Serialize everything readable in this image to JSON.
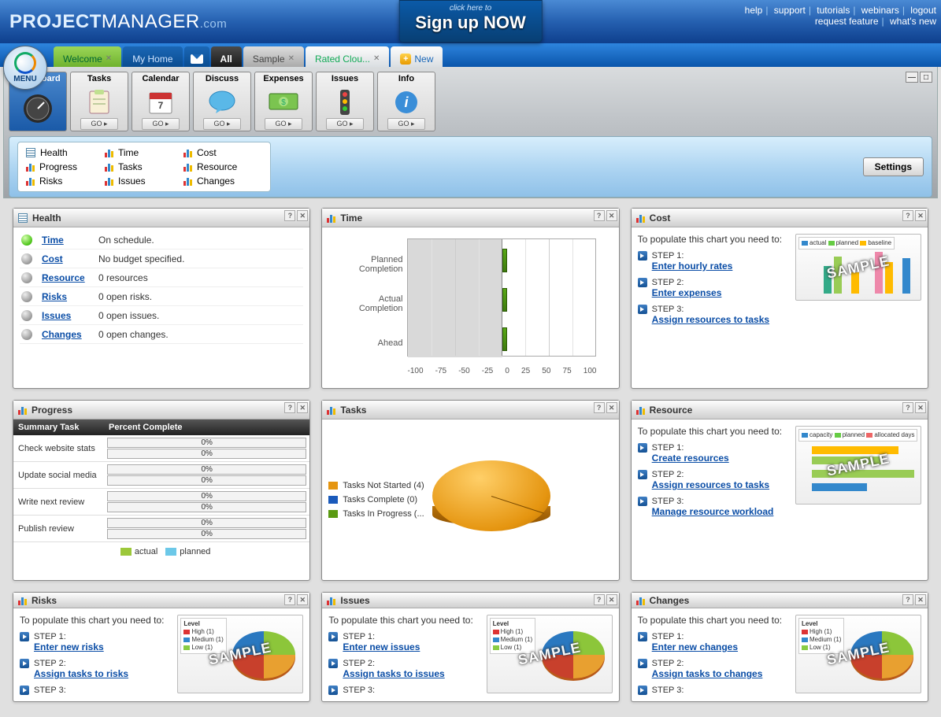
{
  "header": {
    "logo_project": "PROJECT",
    "logo_manager": "MANAGER",
    "logo_com": ".com",
    "signup_click": "click here to",
    "signup_big": "Sign up NOW",
    "links": [
      "help",
      "support",
      "tutorials",
      "webinars",
      "logout",
      "request feature",
      "what's new"
    ]
  },
  "tabs": {
    "welcome": "Welcome",
    "myhome": "My Home",
    "all": "All",
    "sample": "Sample",
    "rated": "Rated Clou...",
    "new": "New"
  },
  "menu_label": "MENU",
  "tiles": [
    {
      "label": "Dashboard",
      "go": "GO ▸"
    },
    {
      "label": "Tasks",
      "go": "GO ▸"
    },
    {
      "label": "Calendar",
      "go": "GO ▸"
    },
    {
      "label": "Discuss",
      "go": "GO ▸"
    },
    {
      "label": "Expenses",
      "go": "GO ▸"
    },
    {
      "label": "Issues",
      "go": "GO ▸"
    },
    {
      "label": "Info",
      "go": "GO ▸"
    }
  ],
  "opts": {
    "col1": [
      "Health",
      "Progress",
      "Risks"
    ],
    "col2": [
      "Time",
      "Tasks",
      "Issues"
    ],
    "col3": [
      "Cost",
      "Resource",
      "Changes"
    ],
    "settings": "Settings"
  },
  "panels": {
    "health": {
      "title": "Health",
      "rows": [
        {
          "link": "Time",
          "text": "On schedule."
        },
        {
          "link": "Cost",
          "text": "No budget specified."
        },
        {
          "link": "Resource",
          "text": "0 resources"
        },
        {
          "link": "Risks",
          "text": "0 open risks."
        },
        {
          "link": "Issues",
          "text": "0 open issues."
        },
        {
          "link": "Changes",
          "text": "0 open changes."
        }
      ]
    },
    "time": {
      "title": "Time"
    },
    "cost": {
      "title": "Cost",
      "intro": "To populate this chart you need to:",
      "steps": [
        {
          "label": "STEP 1:",
          "link": "Enter hourly rates"
        },
        {
          "label": "STEP 2:",
          "link": "Enter expenses"
        },
        {
          "label": "STEP 3:",
          "link": "Assign resources to tasks"
        }
      ],
      "legend": [
        "actual",
        "planned",
        "baseline"
      ]
    },
    "progress": {
      "title": "Progress",
      "col1": "Summary Task",
      "col2": "Percent Complete",
      "rows": [
        {
          "name": "Check website stats",
          "a": "0%",
          "p": "0%"
        },
        {
          "name": "Update social media",
          "a": "0%",
          "p": "0%"
        },
        {
          "name": "Write next review",
          "a": "0%",
          "p": "0%"
        },
        {
          "name": "Publish review",
          "a": "0%",
          "p": "0%"
        }
      ],
      "leg_a": "actual",
      "leg_p": "planned"
    },
    "tasks": {
      "title": "Tasks",
      "legend": [
        {
          "text": "Tasks Not Started (4)",
          "color": "#e59510"
        },
        {
          "text": "Tasks Complete (0)",
          "color": "#1a5abb"
        },
        {
          "text": "Tasks In Progress (...",
          "color": "#5a9a12"
        }
      ]
    },
    "resource": {
      "title": "Resource",
      "intro": "To populate this chart you need to:",
      "steps": [
        {
          "label": "STEP 1:",
          "link": "Create resources"
        },
        {
          "label": "STEP 2:",
          "link": "Assign resources to tasks"
        },
        {
          "label": "STEP 3:",
          "link": "Manage resource workload"
        }
      ],
      "legend": [
        "capacity",
        "planned",
        "allocated days"
      ]
    },
    "risks": {
      "title": "Risks",
      "intro": "To populate this chart you need to:",
      "steps": [
        {
          "label": "STEP 1:",
          "link": "Enter new risks"
        },
        {
          "label": "STEP 2:",
          "link": "Assign tasks to risks"
        },
        {
          "label": "STEP 3:",
          "link": ""
        }
      ]
    },
    "issues": {
      "title": "Issues",
      "intro": "To populate this chart you need to:",
      "steps": [
        {
          "label": "STEP 1:",
          "link": "Enter new issues"
        },
        {
          "label": "STEP 2:",
          "link": "Assign tasks to issues"
        },
        {
          "label": "STEP 3:",
          "link": ""
        }
      ]
    },
    "changes": {
      "title": "Changes",
      "intro": "To populate this chart you need to:",
      "steps": [
        {
          "label": "STEP 1:",
          "link": "Enter new changes"
        },
        {
          "label": "STEP 2:",
          "link": "Assign tasks to changes"
        },
        {
          "label": "STEP 3:",
          "link": ""
        }
      ]
    },
    "level_legend": {
      "title": "Level",
      "items": [
        "High (1)",
        "Medium (1)",
        "Low (1)"
      ]
    }
  },
  "sample": "SAMPLE",
  "chart_data": {
    "time_chart": {
      "type": "bar",
      "orientation": "horizontal",
      "categories": [
        "Planned Completion",
        "Actual Completion",
        "Ahead"
      ],
      "values": [
        3,
        3,
        3
      ],
      "xticks": [
        -100,
        -75,
        -50,
        -25,
        0,
        25,
        50,
        75,
        100
      ],
      "xlim": [
        -100,
        100
      ]
    },
    "tasks_pie": {
      "type": "pie",
      "series": [
        {
          "name": "Tasks Not Started",
          "value": 4
        },
        {
          "name": "Tasks Complete",
          "value": 0
        },
        {
          "name": "Tasks In Progress",
          "value": 0
        }
      ]
    },
    "progress_chart": {
      "type": "bar",
      "tasks": [
        "Check website stats",
        "Update social media",
        "Write next review",
        "Publish review"
      ],
      "actual": [
        0,
        0,
        0,
        0
      ],
      "planned": [
        0,
        0,
        0,
        0
      ],
      "unit": "percent"
    }
  }
}
